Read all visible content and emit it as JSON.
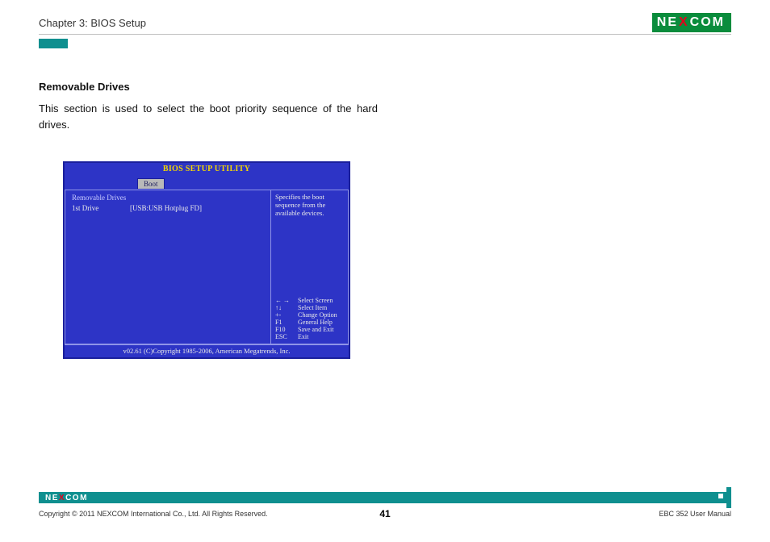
{
  "header": {
    "chapter": "Chapter 3: BIOS Setup",
    "logo_text_left": "NE",
    "logo_text_x": "X",
    "logo_text_right": "COM"
  },
  "section": {
    "title": "Removable Drives",
    "description": "This section is used to select the boot priority sequence of the hard drives."
  },
  "bios": {
    "title": "BIOS SETUP UTILITY",
    "active_tab": "Boot",
    "left_heading": "Removable Drives",
    "rows": [
      {
        "label": "1st Drive",
        "value": "[USB:USB Hotplug FD]"
      }
    ],
    "help_text": "Specifies the boot sequence from the available devices.",
    "keys": [
      {
        "key": "← →",
        "action": "Select Screen"
      },
      {
        "key": "↑↓",
        "action": "Select Item"
      },
      {
        "key": "+-",
        "action": "Change Option"
      },
      {
        "key": "F1",
        "action": "General Help"
      },
      {
        "key": "F10",
        "action": "Save and Exit"
      },
      {
        "key": "ESC",
        "action": "Exit"
      }
    ],
    "footer": "v02.61 (C)Copyright 1985-2006, American Megatrends, Inc."
  },
  "footer": {
    "copyright": "Copyright © 2011 NEXCOM International Co., Ltd. All Rights Reserved.",
    "manual": "EBC 352 User Manual",
    "page": "41",
    "logo_text_left": "NE",
    "logo_text_x": "X",
    "logo_text_right": "COM"
  }
}
